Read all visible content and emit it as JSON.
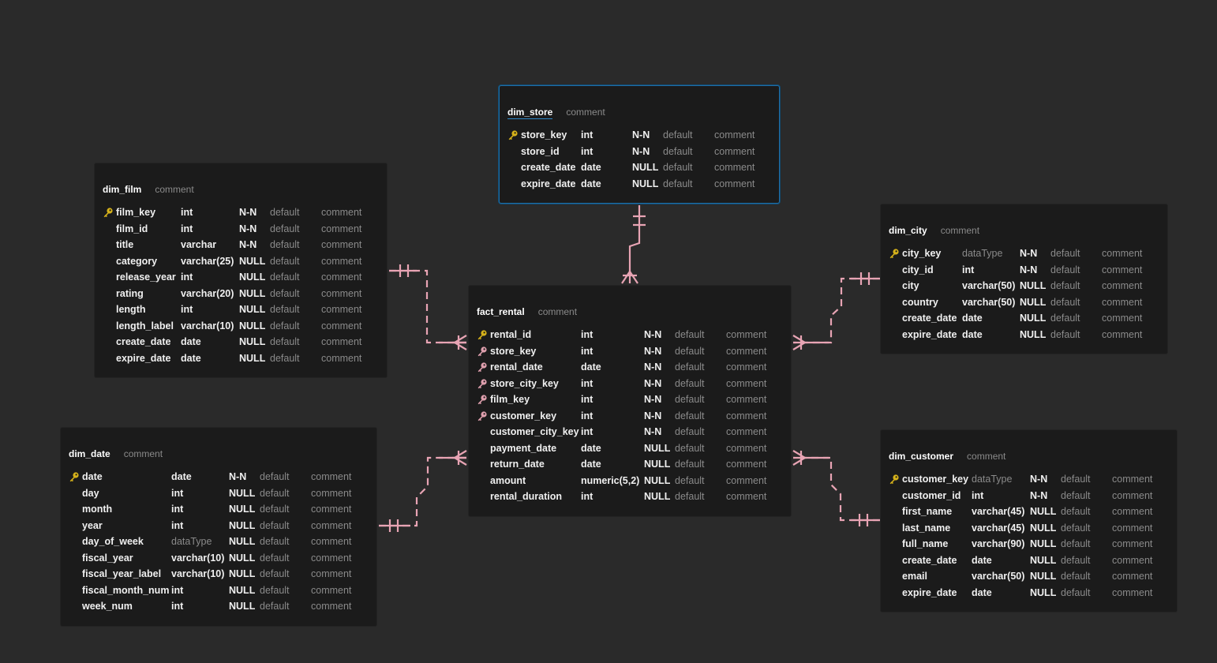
{
  "colors": {
    "background": "#2a2a2a",
    "table_bg": "#1b1b1b",
    "link": "#e8a4b4",
    "primary_key": "#d6b21a",
    "foreign_key": "#e0a0ae",
    "selected_border": "#1f6fa8"
  },
  "tables": [
    {
      "id": "dim_store",
      "name": "dim_store",
      "comment": "comment",
      "selected": true,
      "columns": [
        {
          "name": "store_key",
          "type": "int",
          "nullable": "N-N",
          "default": "default",
          "comment": "comment",
          "key": "pk"
        },
        {
          "name": "store_id",
          "type": "int",
          "nullable": "N-N",
          "default": "default",
          "comment": "comment",
          "key": ""
        },
        {
          "name": "create_date",
          "type": "date",
          "nullable": "NULL",
          "default": "default",
          "comment": "comment",
          "key": ""
        },
        {
          "name": "expire_date",
          "type": "date",
          "nullable": "NULL",
          "default": "default",
          "comment": "comment",
          "key": ""
        }
      ]
    },
    {
      "id": "dim_film",
      "name": "dim_film",
      "comment": "comment",
      "selected": false,
      "columns": [
        {
          "name": "film_key",
          "type": "int",
          "nullable": "N-N",
          "default": "default",
          "comment": "comment",
          "key": "pk"
        },
        {
          "name": "film_id",
          "type": "int",
          "nullable": "N-N",
          "default": "default",
          "comment": "comment",
          "key": ""
        },
        {
          "name": "title",
          "type": "varchar",
          "nullable": "N-N",
          "default": "default",
          "comment": "comment",
          "key": ""
        },
        {
          "name": "category",
          "type": "varchar(25)",
          "nullable": "NULL",
          "default": "default",
          "comment": "comment",
          "key": ""
        },
        {
          "name": "release_year",
          "type": "int",
          "nullable": "NULL",
          "default": "default",
          "comment": "comment",
          "key": ""
        },
        {
          "name": "rating",
          "type": "varchar(20)",
          "nullable": "NULL",
          "default": "default",
          "comment": "comment",
          "key": ""
        },
        {
          "name": "length",
          "type": "int",
          "nullable": "NULL",
          "default": "default",
          "comment": "comment",
          "key": ""
        },
        {
          "name": "length_label",
          "type": "varchar(10)",
          "nullable": "NULL",
          "default": "default",
          "comment": "comment",
          "key": ""
        },
        {
          "name": "create_date",
          "type": "date",
          "nullable": "NULL",
          "default": "default",
          "comment": "comment",
          "key": ""
        },
        {
          "name": "expire_date",
          "type": "date",
          "nullable": "NULL",
          "default": "default",
          "comment": "comment",
          "key": ""
        }
      ]
    },
    {
      "id": "dim_city",
      "name": "dim_city",
      "comment": "comment",
      "selected": false,
      "columns": [
        {
          "name": "city_key",
          "type": "dataType",
          "nullable": "N-N",
          "default": "default",
          "comment": "comment",
          "key": "pk"
        },
        {
          "name": "city_id",
          "type": "int",
          "nullable": "N-N",
          "default": "default",
          "comment": "comment",
          "key": ""
        },
        {
          "name": "city",
          "type": "varchar(50)",
          "nullable": "NULL",
          "default": "default",
          "comment": "comment",
          "key": ""
        },
        {
          "name": "country",
          "type": "varchar(50)",
          "nullable": "NULL",
          "default": "default",
          "comment": "comment",
          "key": ""
        },
        {
          "name": "create_date",
          "type": "date",
          "nullable": "NULL",
          "default": "default",
          "comment": "comment",
          "key": ""
        },
        {
          "name": "expire_date",
          "type": "date",
          "nullable": "NULL",
          "default": "default",
          "comment": "comment",
          "key": ""
        }
      ]
    },
    {
      "id": "fact_rental",
      "name": "fact_rental",
      "comment": "comment",
      "selected": false,
      "columns": [
        {
          "name": "rental_id",
          "type": "int",
          "nullable": "N-N",
          "default": "default",
          "comment": "comment",
          "key": "pk"
        },
        {
          "name": "store_key",
          "type": "int",
          "nullable": "N-N",
          "default": "default",
          "comment": "comment",
          "key": "fk"
        },
        {
          "name": "rental_date",
          "type": "date",
          "nullable": "N-N",
          "default": "default",
          "comment": "comment",
          "key": "fk"
        },
        {
          "name": "store_city_key",
          "type": "int",
          "nullable": "N-N",
          "default": "default",
          "comment": "comment",
          "key": "fk"
        },
        {
          "name": "film_key",
          "type": "int",
          "nullable": "N-N",
          "default": "default",
          "comment": "comment",
          "key": "fk"
        },
        {
          "name": "customer_key",
          "type": "int",
          "nullable": "N-N",
          "default": "default",
          "comment": "comment",
          "key": "fk"
        },
        {
          "name": "customer_city_key",
          "type": "int",
          "nullable": "N-N",
          "default": "default",
          "comment": "comment",
          "key": ""
        },
        {
          "name": "payment_date",
          "type": "date",
          "nullable": "NULL",
          "default": "default",
          "comment": "comment",
          "key": ""
        },
        {
          "name": "return_date",
          "type": "date",
          "nullable": "NULL",
          "default": "default",
          "comment": "comment",
          "key": ""
        },
        {
          "name": "amount",
          "type": "numeric(5,2)",
          "nullable": "NULL",
          "default": "default",
          "comment": "comment",
          "key": ""
        },
        {
          "name": "rental_duration",
          "type": "int",
          "nullable": "NULL",
          "default": "default",
          "comment": "comment",
          "key": ""
        }
      ]
    },
    {
      "id": "dim_date",
      "name": "dim_date",
      "comment": "comment",
      "selected": false,
      "columns": [
        {
          "name": "date",
          "type": "date",
          "nullable": "N-N",
          "default": "default",
          "comment": "comment",
          "key": "pk"
        },
        {
          "name": "day",
          "type": "int",
          "nullable": "NULL",
          "default": "default",
          "comment": "comment",
          "key": ""
        },
        {
          "name": "month",
          "type": "int",
          "nullable": "NULL",
          "default": "default",
          "comment": "comment",
          "key": ""
        },
        {
          "name": "year",
          "type": "int",
          "nullable": "NULL",
          "default": "default",
          "comment": "comment",
          "key": ""
        },
        {
          "name": "day_of_week",
          "type": "dataType",
          "nullable": "NULL",
          "default": "default",
          "comment": "comment",
          "key": ""
        },
        {
          "name": "fiscal_year",
          "type": "varchar(10)",
          "nullable": "NULL",
          "default": "default",
          "comment": "comment",
          "key": ""
        },
        {
          "name": "fiscal_year_label",
          "type": "varchar(10)",
          "nullable": "NULL",
          "default": "default",
          "comment": "comment",
          "key": ""
        },
        {
          "name": "fiscal_month_num",
          "type": "int",
          "nullable": "NULL",
          "default": "default",
          "comment": "comment",
          "key": ""
        },
        {
          "name": "week_num",
          "type": "int",
          "nullable": "NULL",
          "default": "default",
          "comment": "comment",
          "key": ""
        }
      ]
    },
    {
      "id": "dim_customer",
      "name": "dim_customer",
      "comment": "comment",
      "selected": false,
      "columns": [
        {
          "name": "customer_key",
          "type": "dataType",
          "nullable": "N-N",
          "default": "default",
          "comment": "comment",
          "key": "pk"
        },
        {
          "name": "customer_id",
          "type": "int",
          "nullable": "N-N",
          "default": "default",
          "comment": "comment",
          "key": ""
        },
        {
          "name": "first_name",
          "type": "varchar(45)",
          "nullable": "NULL",
          "default": "default",
          "comment": "comment",
          "key": ""
        },
        {
          "name": "last_name",
          "type": "varchar(45)",
          "nullable": "NULL",
          "default": "default",
          "comment": "comment",
          "key": ""
        },
        {
          "name": "full_name",
          "type": "varchar(90)",
          "nullable": "NULL",
          "default": "default",
          "comment": "comment",
          "key": ""
        },
        {
          "name": "create_date",
          "type": "date",
          "nullable": "NULL",
          "default": "default",
          "comment": "comment",
          "key": ""
        },
        {
          "name": "email",
          "type": "varchar(50)",
          "nullable": "NULL",
          "default": "default",
          "comment": "comment",
          "key": ""
        },
        {
          "name": "expire_date",
          "type": "date",
          "nullable": "NULL",
          "default": "default",
          "comment": "comment",
          "key": ""
        }
      ]
    }
  ],
  "relationships": [
    {
      "from": "dim_store",
      "to": "fact_rental",
      "from_cardinality": "one-and-only-one",
      "to_cardinality": "one-or-many"
    },
    {
      "from": "dim_film",
      "to": "fact_rental",
      "from_cardinality": "one-and-only-one",
      "to_cardinality": "one-or-many"
    },
    {
      "from": "dim_city",
      "to": "fact_rental",
      "from_cardinality": "one-and-only-one",
      "to_cardinality": "one-or-many"
    },
    {
      "from": "dim_date",
      "to": "fact_rental",
      "from_cardinality": "one-and-only-one",
      "to_cardinality": "one-or-many"
    },
    {
      "from": "dim_customer",
      "to": "fact_rental",
      "from_cardinality": "one-and-only-one",
      "to_cardinality": "one-or-many"
    }
  ]
}
